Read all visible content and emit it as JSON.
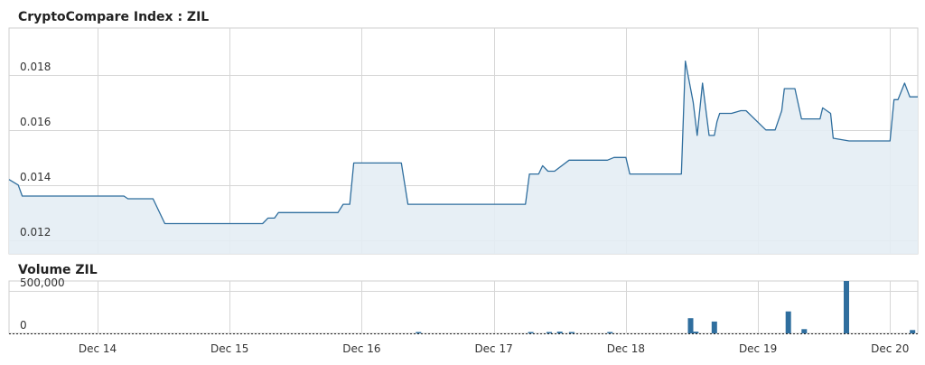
{
  "chart_data": [
    {
      "type": "area",
      "title": "CryptoCompare Index : ZIL",
      "ylim": [
        0.0115,
        0.0197
      ],
      "y_ticks": [
        "0.012",
        "0.014",
        "0.016",
        "0.018"
      ],
      "y_tick_values": [
        0.012,
        0.014,
        0.016,
        0.018
      ],
      "x_ticks": [
        "Dec 14",
        "Dec 15",
        "Dec 16",
        "Dec 17",
        "Dec 18",
        "Dec 19",
        "Dec 20"
      ],
      "x_tick_values": [
        14.0,
        15.0,
        16.0,
        17.0,
        18.0,
        19.0,
        20.0
      ],
      "xlim": [
        13.33,
        20.21
      ],
      "grid": true,
      "colors": {
        "line": "#2f6e9e",
        "fill": "#e4edf4"
      },
      "x": [
        13.33,
        13.4,
        13.43,
        13.48,
        14.1,
        14.2,
        14.23,
        14.42,
        14.51,
        15.2,
        15.25,
        15.29,
        15.34,
        15.37,
        15.6,
        15.82,
        15.86,
        15.91,
        15.94,
        16.3,
        16.35,
        17.24,
        17.27,
        17.34,
        17.37,
        17.41,
        17.46,
        17.57,
        17.61,
        17.86,
        17.91,
        18.0,
        18.03,
        18.42,
        18.45,
        18.51,
        18.54,
        18.58,
        18.63,
        18.67,
        18.69,
        18.71,
        18.75,
        18.8,
        18.87,
        18.91,
        19.06,
        19.09,
        19.13,
        19.18,
        19.2,
        19.28,
        19.33,
        19.4,
        19.47,
        19.49,
        19.55,
        19.57,
        19.69,
        19.72,
        19.76,
        19.8,
        20.0,
        20.03,
        20.06,
        20.11,
        20.15,
        20.21
      ],
      "y": [
        0.0142,
        0.014,
        0.0136,
        0.0136,
        0.0136,
        0.0136,
        0.0135,
        0.0135,
        0.0126,
        0.0126,
        0.0126,
        0.0128,
        0.0128,
        0.013,
        0.013,
        0.013,
        0.0133,
        0.0133,
        0.0148,
        0.0148,
        0.0133,
        0.0133,
        0.0144,
        0.0144,
        0.0147,
        0.0145,
        0.0145,
        0.0149,
        0.0149,
        0.0149,
        0.015,
        0.015,
        0.0144,
        0.0144,
        0.0185,
        0.017,
        0.0158,
        0.0177,
        0.0158,
        0.0158,
        0.0163,
        0.0166,
        0.0166,
        0.0166,
        0.0167,
        0.0167,
        0.016,
        0.016,
        0.016,
        0.0167,
        0.0175,
        0.0175,
        0.0164,
        0.0164,
        0.0164,
        0.0168,
        0.0166,
        0.0157,
        0.0156,
        0.0156,
        0.0156,
        0.0156,
        0.0156,
        0.0171,
        0.0171,
        0.0177,
        0.0172,
        0.0172
      ]
    },
    {
      "type": "bar",
      "title": "Volume ZIL",
      "ylim": [
        0,
        620000
      ],
      "y_ticks": [
        "0",
        "500,000"
      ],
      "y_tick_values": [
        0,
        500000
      ],
      "grid": true,
      "colors": {
        "bar": "#2f6e9e",
        "baseline": "#222222"
      },
      "x": [
        16.43,
        17.28,
        17.42,
        17.5,
        17.59,
        17.88,
        18.49,
        18.53,
        18.67,
        19.23,
        19.35,
        19.67,
        20.17
      ],
      "values": [
        6000,
        10000,
        10000,
        20000,
        16000,
        11000,
        180000,
        20000,
        140000,
        260000,
        50000,
        620000,
        40000
      ]
    }
  ]
}
